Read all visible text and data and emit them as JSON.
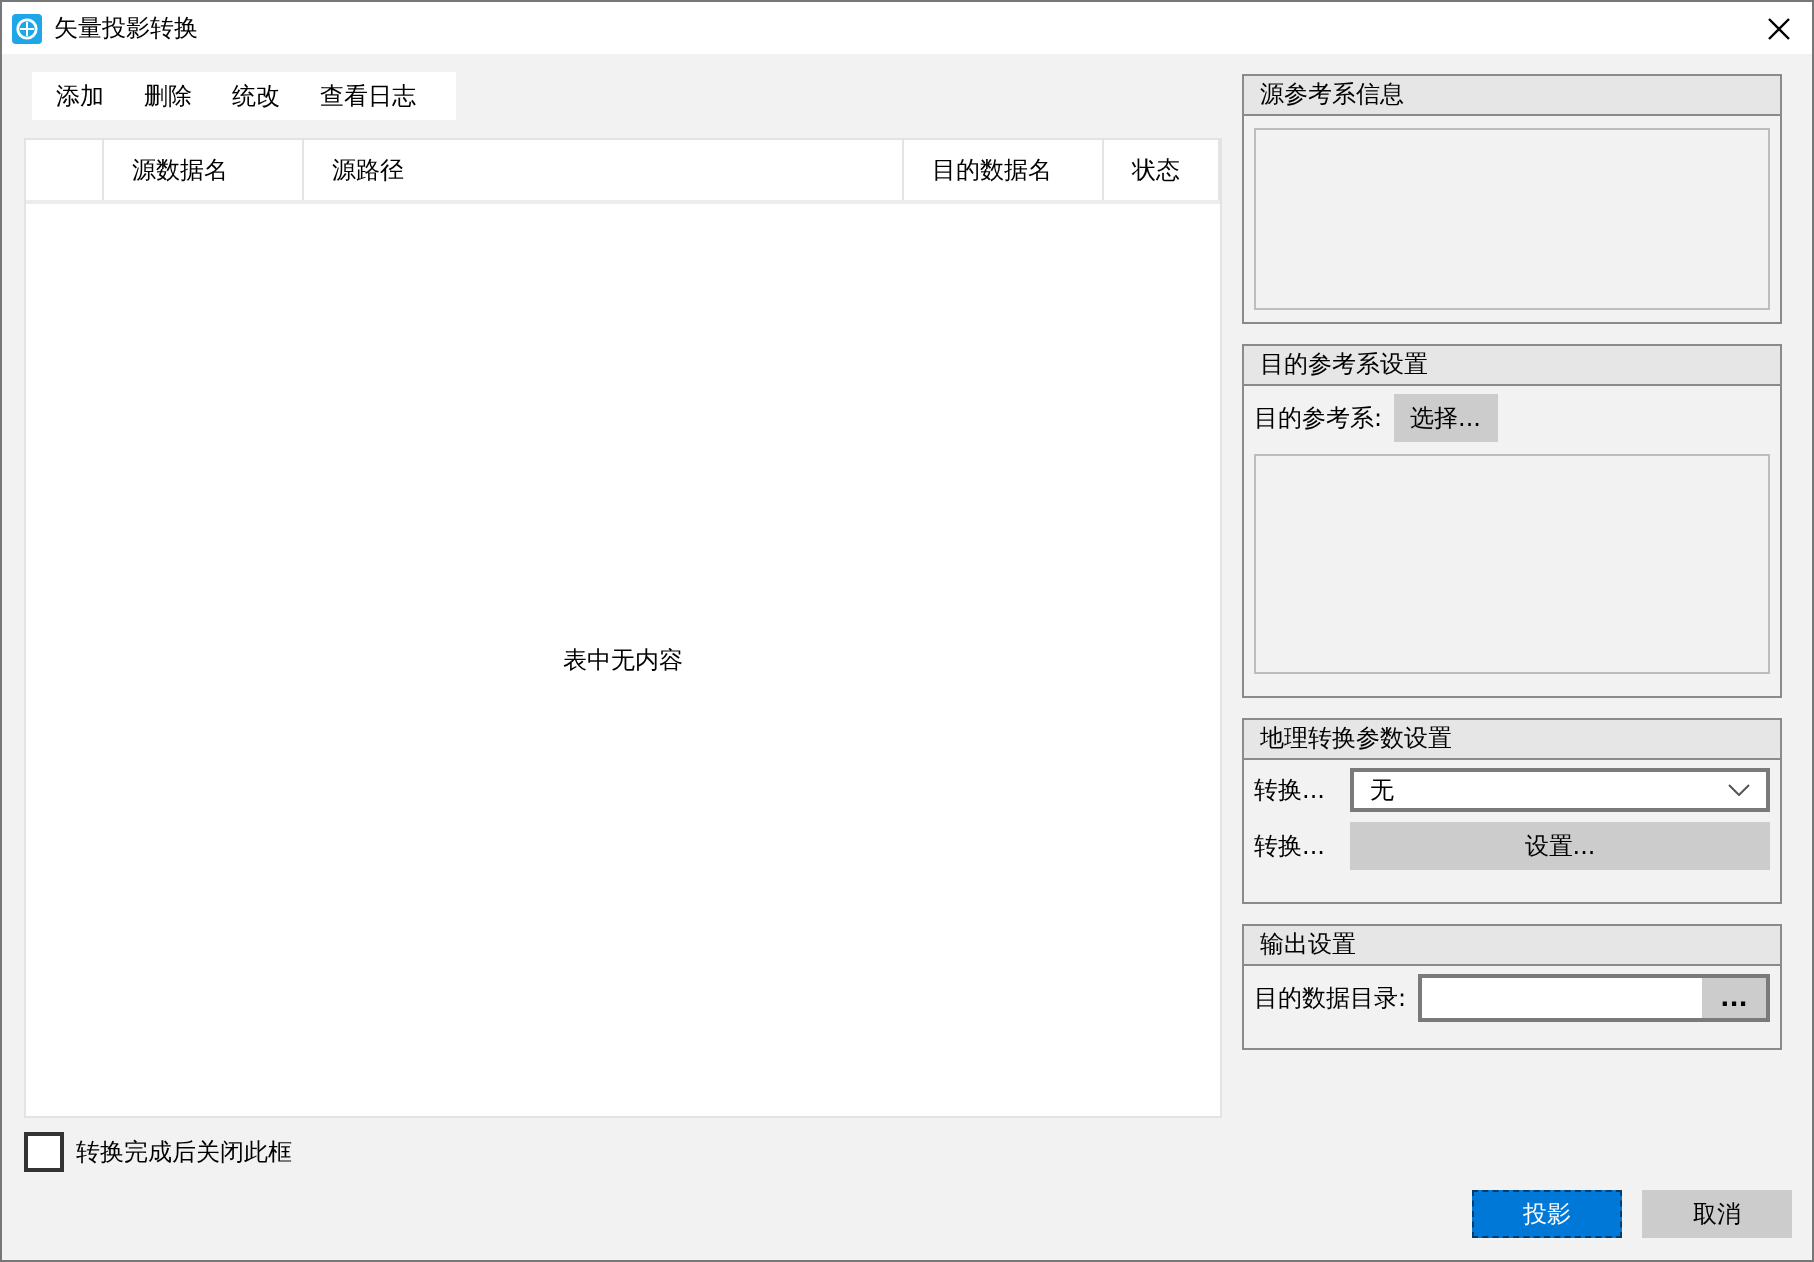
{
  "window": {
    "title": "矢量投影转换"
  },
  "toolbar": [
    "添加",
    "删除",
    "统改",
    "查看日志"
  ],
  "table": {
    "columns": [
      "源数据名",
      "源路径",
      "目的数据名",
      "状态"
    ],
    "empty_message": "表中无内容"
  },
  "source_crs": {
    "title": "源参考系信息"
  },
  "target_crs": {
    "title": "目的参考系设置",
    "label": "目的参考系:",
    "button": "选择..."
  },
  "geo_transform": {
    "title": "地理转换参数设置",
    "method_label": "转换...",
    "method_value": "无",
    "params_label": "转换...",
    "params_button": "设置..."
  },
  "output": {
    "title": "输出设置",
    "dir_label": "目的数据目录:",
    "browse_button": "..."
  },
  "close_after": {
    "label": "转换完成后关闭此框",
    "checked": false
  },
  "buttons": [
    {
      "label": "投影",
      "kind": "primary"
    },
    {
      "label": "取消",
      "kind": "normal"
    }
  ]
}
